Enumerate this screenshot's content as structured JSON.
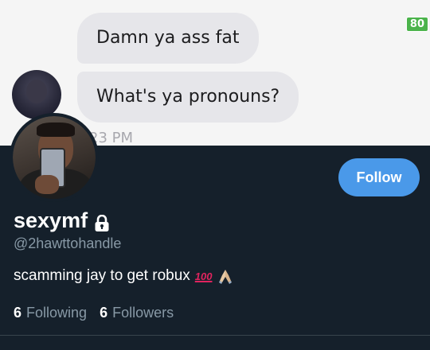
{
  "banner": {
    "messages": [
      {
        "text": "Damn ya ass fat"
      },
      {
        "text": "What's ya pronouns?"
      }
    ],
    "timestamp": "23 PM",
    "corner_badge": "80"
  },
  "profile": {
    "display_name": "sexymf",
    "handle": "@2hawttohandle",
    "bio": "scamming jay to get robux",
    "bio_emojis": [
      "100-emoji",
      "folded-hands-emoji"
    ],
    "emoji_100_text": "100",
    "follow_label": "Follow",
    "following_count": "6",
    "following_label": "Following",
    "followers_count": "6",
    "followers_label": "Followers"
  },
  "colors": {
    "background": "#15202b",
    "accent": "#4a99e9",
    "secondary_text": "#8899a6"
  }
}
